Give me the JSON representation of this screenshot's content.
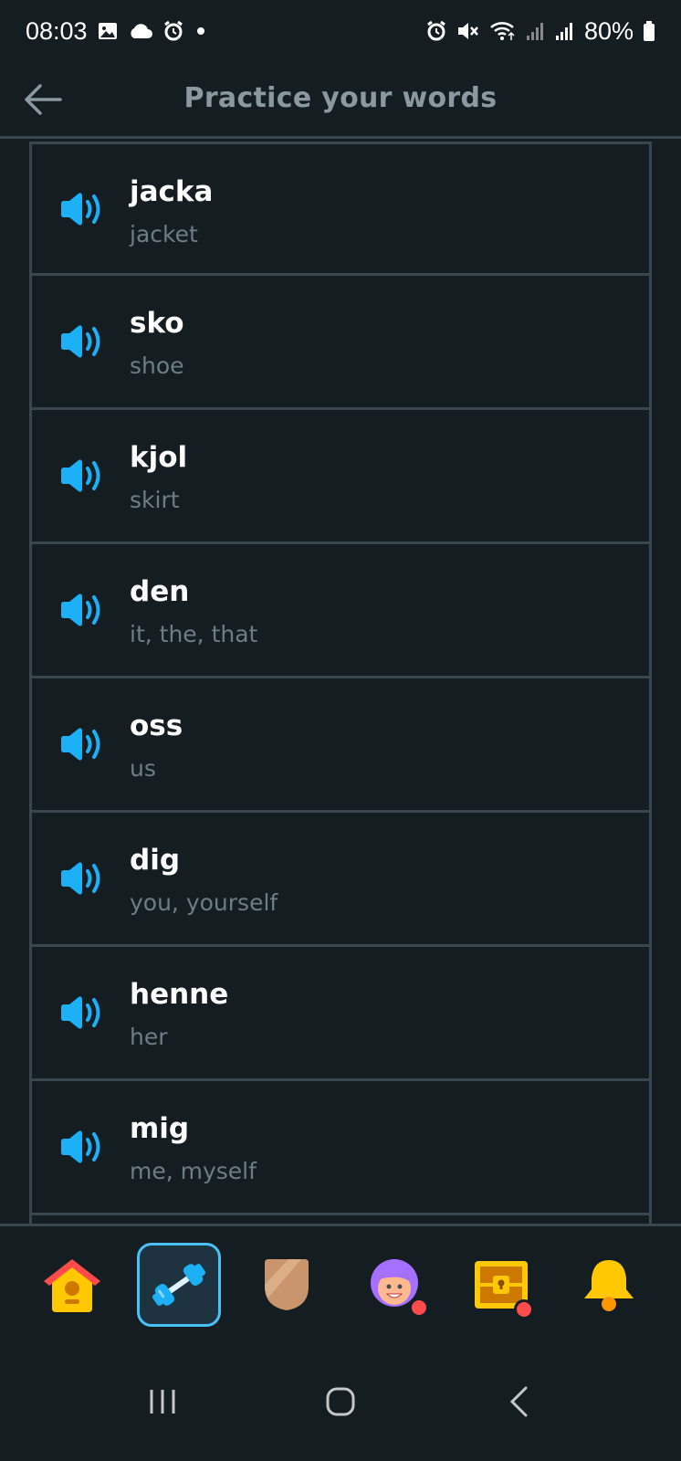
{
  "status_bar": {
    "time": "08:03",
    "battery": "80%",
    "left_icons": [
      "gallery-icon",
      "cloud-icon",
      "alarm-icon",
      "dot-icon"
    ],
    "right_icons": [
      "alarm-icon",
      "mute-icon",
      "wifi-icon",
      "signal-icon",
      "signal-icon",
      "battery-icon"
    ]
  },
  "header": {
    "title": "Practice your words",
    "back_icon": "arrow-left-icon"
  },
  "words": [
    {
      "word": "jacka",
      "translation": "jacket"
    },
    {
      "word": "sko",
      "translation": "shoe"
    },
    {
      "word": "kjol",
      "translation": "skirt"
    },
    {
      "word": "den",
      "translation": "it, the, that"
    },
    {
      "word": "oss",
      "translation": "us"
    },
    {
      "word": "dig",
      "translation": "you, yourself"
    },
    {
      "word": "henne",
      "translation": "her"
    },
    {
      "word": "mig",
      "translation": "me, myself"
    }
  ],
  "bottom_nav": {
    "items": [
      "home-icon",
      "practice-dumbbell-icon",
      "league-shield-icon",
      "profile-avatar-icon",
      "treasure-chest-icon",
      "notifications-bell-icon"
    ],
    "active": "practice-dumbbell-icon"
  },
  "colors": {
    "background": "#141e22",
    "border": "#37464f",
    "accent_blue": "#49c0f8",
    "speaker_blue": "#1cb0f6",
    "muted_text": "#6e7d84",
    "title_text": "#8a999f"
  }
}
